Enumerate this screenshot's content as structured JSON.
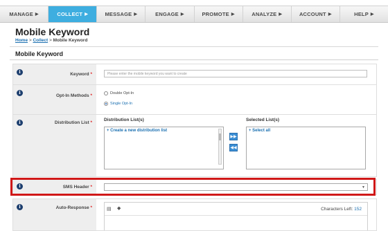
{
  "nav": [
    {
      "label": "MANAGE",
      "active": false
    },
    {
      "label": "COLLECT",
      "active": true
    },
    {
      "label": "MESSAGE",
      "active": false
    },
    {
      "label": "ENGAGE",
      "active": false
    },
    {
      "label": "PROMOTE",
      "active": false
    },
    {
      "label": "ANALYZE",
      "active": false
    },
    {
      "label": "ACCOUNT",
      "active": false
    },
    {
      "label": "HELP",
      "active": false
    }
  ],
  "page": {
    "title": "Mobile Keyword",
    "breadcrumb": {
      "home": "Home",
      "sep": ">",
      "collect": "Collect",
      "current": "Mobile Keyword"
    },
    "section_title": "Mobile Keyword"
  },
  "info_glyph": "i",
  "required_mark": "*",
  "form": {
    "keyword": {
      "label": "Keyword",
      "placeholder": "Please enter the mobile keyword you want to create"
    },
    "optin": {
      "label": "Opt-In Methods",
      "options": [
        {
          "label": "Double Opt-In",
          "checked": false
        },
        {
          "label": "Single Opt-In",
          "checked": true
        }
      ]
    },
    "distribution": {
      "label": "Distribution List",
      "available_title": "Distribution List(s)",
      "available_item": "+ Create a new distribution list",
      "selected_title": "Selected List(s)",
      "selected_item": "+ Select all",
      "add_glyph": "▶▶",
      "remove_glyph": "◀◀"
    },
    "sms_header": {
      "label": "SMS Header",
      "value": "",
      "caret": "▼"
    },
    "auto_response": {
      "label": "Auto-Response",
      "chars_label": "Characters Left:",
      "chars_left": "152"
    }
  },
  "colors": {
    "accent": "#3eaee0",
    "highlight": "#d01818",
    "link": "#1a6fb0"
  },
  "icons": {
    "nav_arrow": "arrow-right-icon",
    "info": "info-icon",
    "merge": "merge-field-icon",
    "tag": "tag-icon"
  }
}
